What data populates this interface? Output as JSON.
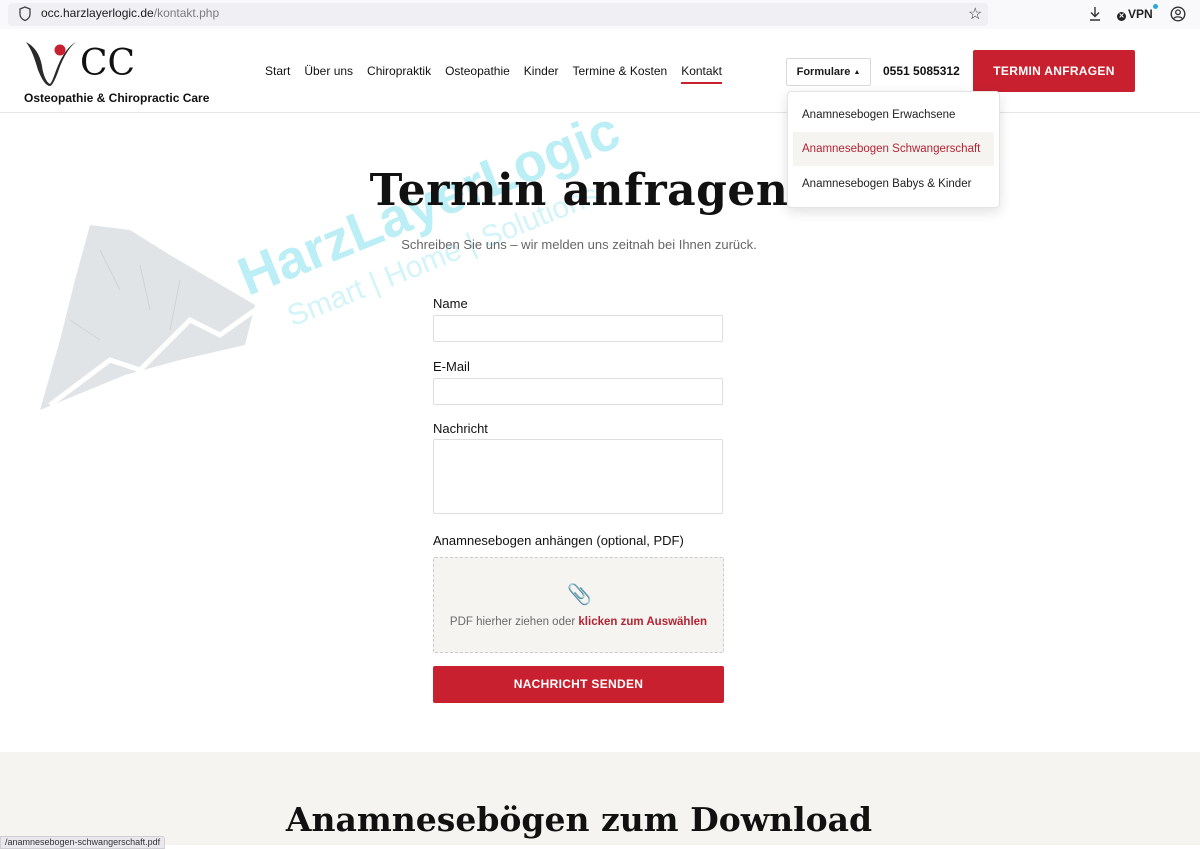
{
  "browser": {
    "url_domain": "occ.harzlayerlogic.de",
    "url_path": "/kontakt.php",
    "vpn_label": "VPN",
    "status_link": "/anamnesebogen-schwangerschaft.pdf"
  },
  "header": {
    "logo_text": "CC",
    "logo_tagline": "Osteopathie & Chiropractic Care",
    "nav": [
      "Start",
      "Über uns",
      "Chiropraktik",
      "Osteopathie",
      "Kinder",
      "Termine & Kosten",
      "Kontakt"
    ],
    "active_nav": "Kontakt",
    "formulare_label": "Formulare",
    "formulare_arrow": "▲",
    "phone": "0551 5085312",
    "cta_label": "TERMIN ANFRAGEN"
  },
  "dropdown": {
    "items": [
      "Anamnesebogen Erwachsene",
      "Anamnesebogen Schwangerschaft",
      "Anamnesebogen Babys & Kinder"
    ],
    "hovered_index": 1
  },
  "watermark": {
    "brand": "HarzLayerLogic",
    "tagline": "Smart | Home | Solutions"
  },
  "main": {
    "title": "Termin anfragen",
    "subtitle": "Schreiben Sie uns – wir melden uns zeitnah bei Ihnen zurück.",
    "fields": {
      "name_label": "Name",
      "email_label": "E-Mail",
      "message_label": "Nachricht",
      "attach_label": "Anamnesebogen anhängen (optional, PDF)"
    },
    "dropzone": {
      "text": "PDF hierher ziehen oder",
      "link": "klicken zum Auswählen"
    },
    "submit_label": "NACHRICHT SENDEN"
  },
  "downloads": {
    "heading": "Anamnesebögen zum Download"
  },
  "colors": {
    "accent": "#c8202f",
    "muted_bg": "#f5f4f1",
    "watermark": "#8fe3f0"
  }
}
